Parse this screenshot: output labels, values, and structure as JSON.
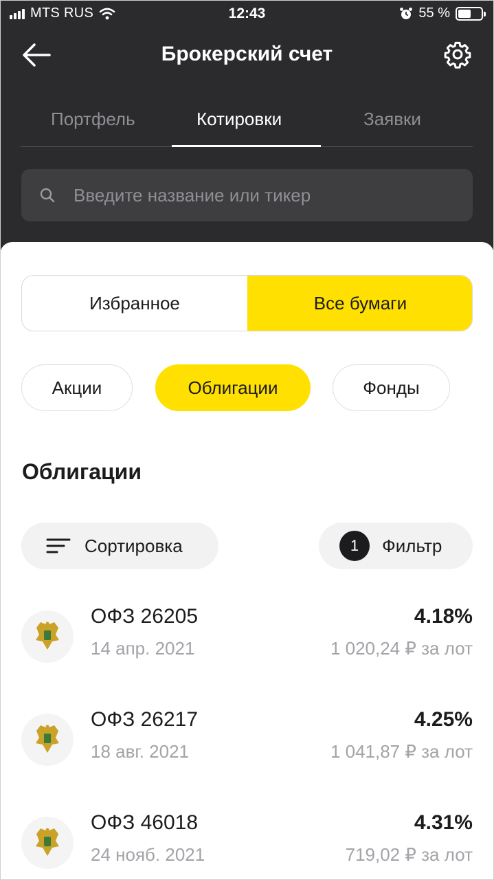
{
  "status_bar": {
    "carrier": "MTS RUS",
    "time": "12:43",
    "battery_percent": "55 %",
    "battery_level": 0.55
  },
  "header": {
    "title": "Брокерский счет"
  },
  "tabs": [
    {
      "label": "Портфель",
      "active": false
    },
    {
      "label": "Котировки",
      "active": true
    },
    {
      "label": "Заявки",
      "active": false
    }
  ],
  "search": {
    "placeholder": "Введите название или тикер",
    "value": ""
  },
  "segment": {
    "favorites_label": "Избранное",
    "all_label": "Все бумаги",
    "selected": "all"
  },
  "chips": [
    {
      "label": "Акции",
      "active": false
    },
    {
      "label": "Облигации",
      "active": true
    },
    {
      "label": "Фонды",
      "active": false
    }
  ],
  "section": {
    "title": "Облигации"
  },
  "controls": {
    "sort_label": "Сортировка",
    "filter_label": "Фильтр",
    "filter_count": "1"
  },
  "bonds": [
    {
      "name": "ОФЗ 26205",
      "date": "14 апр. 2021",
      "yield": "4.18%",
      "price": "1 020,24 ₽ за лот"
    },
    {
      "name": "ОФЗ 26217",
      "date": "18 авг. 2021",
      "yield": "4.25%",
      "price": "1 041,87 ₽ за лот"
    },
    {
      "name": "ОФЗ 46018",
      "date": "24 нояб. 2021",
      "yield": "4.31%",
      "price": "719,02 ₽ за лот"
    }
  ],
  "colors": {
    "accent_yellow": "#ffe000",
    "dark_bg": "#2b2b2d",
    "emblem_gold": "#c9a227",
    "emblem_green": "#3d7a3a"
  },
  "icons": {
    "back": "arrow-left-icon",
    "settings": "gear-icon",
    "search": "search-icon",
    "sort": "sort-lines-icon",
    "bond": "russian-emblem-icon"
  }
}
